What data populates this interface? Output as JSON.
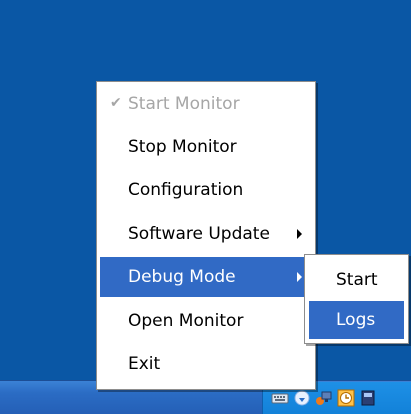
{
  "menu": {
    "items": [
      {
        "label": "Start Monitor",
        "disabled": true,
        "checked": true
      },
      {
        "label": "Stop Monitor"
      },
      {
        "label": "Configuration"
      },
      {
        "label": "Software Update",
        "has_submenu": true
      },
      {
        "label": "Debug Mode",
        "has_submenu": true,
        "active": true
      },
      {
        "label": "Open Monitor"
      },
      {
        "label": "Exit"
      }
    ]
  },
  "submenu": {
    "items": [
      {
        "label": "Start"
      },
      {
        "label": "Logs",
        "active": true
      }
    ]
  },
  "tray": {
    "icons": [
      "keyboard-icon",
      "network-shield-icon",
      "network-computers-icon",
      "clock-icon",
      "extra-tray-icon"
    ]
  },
  "colors": {
    "desktop": "#0a57a5",
    "highlight": "#316ac5",
    "disabled_text": "#a6a6a6"
  }
}
